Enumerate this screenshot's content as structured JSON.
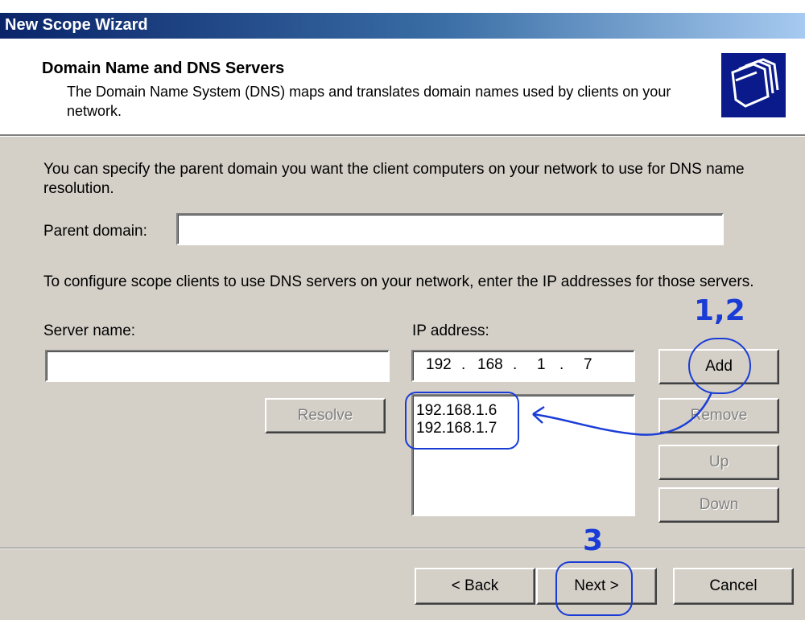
{
  "window": {
    "title": "New Scope Wizard"
  },
  "header": {
    "title": "Domain Name and DNS Servers",
    "description": "The Domain Name System (DNS) maps and translates domain names used by clients on your network."
  },
  "intro_text": "You can specify the parent domain you want the client computers on your network to use for DNS name resolution.",
  "parent_domain": {
    "label": "Parent domain:",
    "value": ""
  },
  "dns_text": "To configure scope clients to use DNS servers on your network, enter the IP addresses for those servers.",
  "server_name": {
    "label": "Server name:",
    "value": ""
  },
  "ip_address": {
    "label": "IP address:",
    "octets": [
      "192",
      "168",
      "1",
      "7"
    ]
  },
  "buttons": {
    "resolve": "Resolve",
    "add": "Add",
    "remove": "Remove",
    "up": "Up",
    "down": "Down",
    "back": "< Back",
    "next": "Next >",
    "cancel": "Cancel"
  },
  "dns_list": [
    "192.168.1.6",
    "192.168.1.7"
  ],
  "annotations": {
    "step_add": "1,2",
    "step_next": "3"
  },
  "colors": {
    "annotation": "#1a3cd6",
    "title_bar": "#0a246a",
    "dialog": "#d4d0c8"
  }
}
